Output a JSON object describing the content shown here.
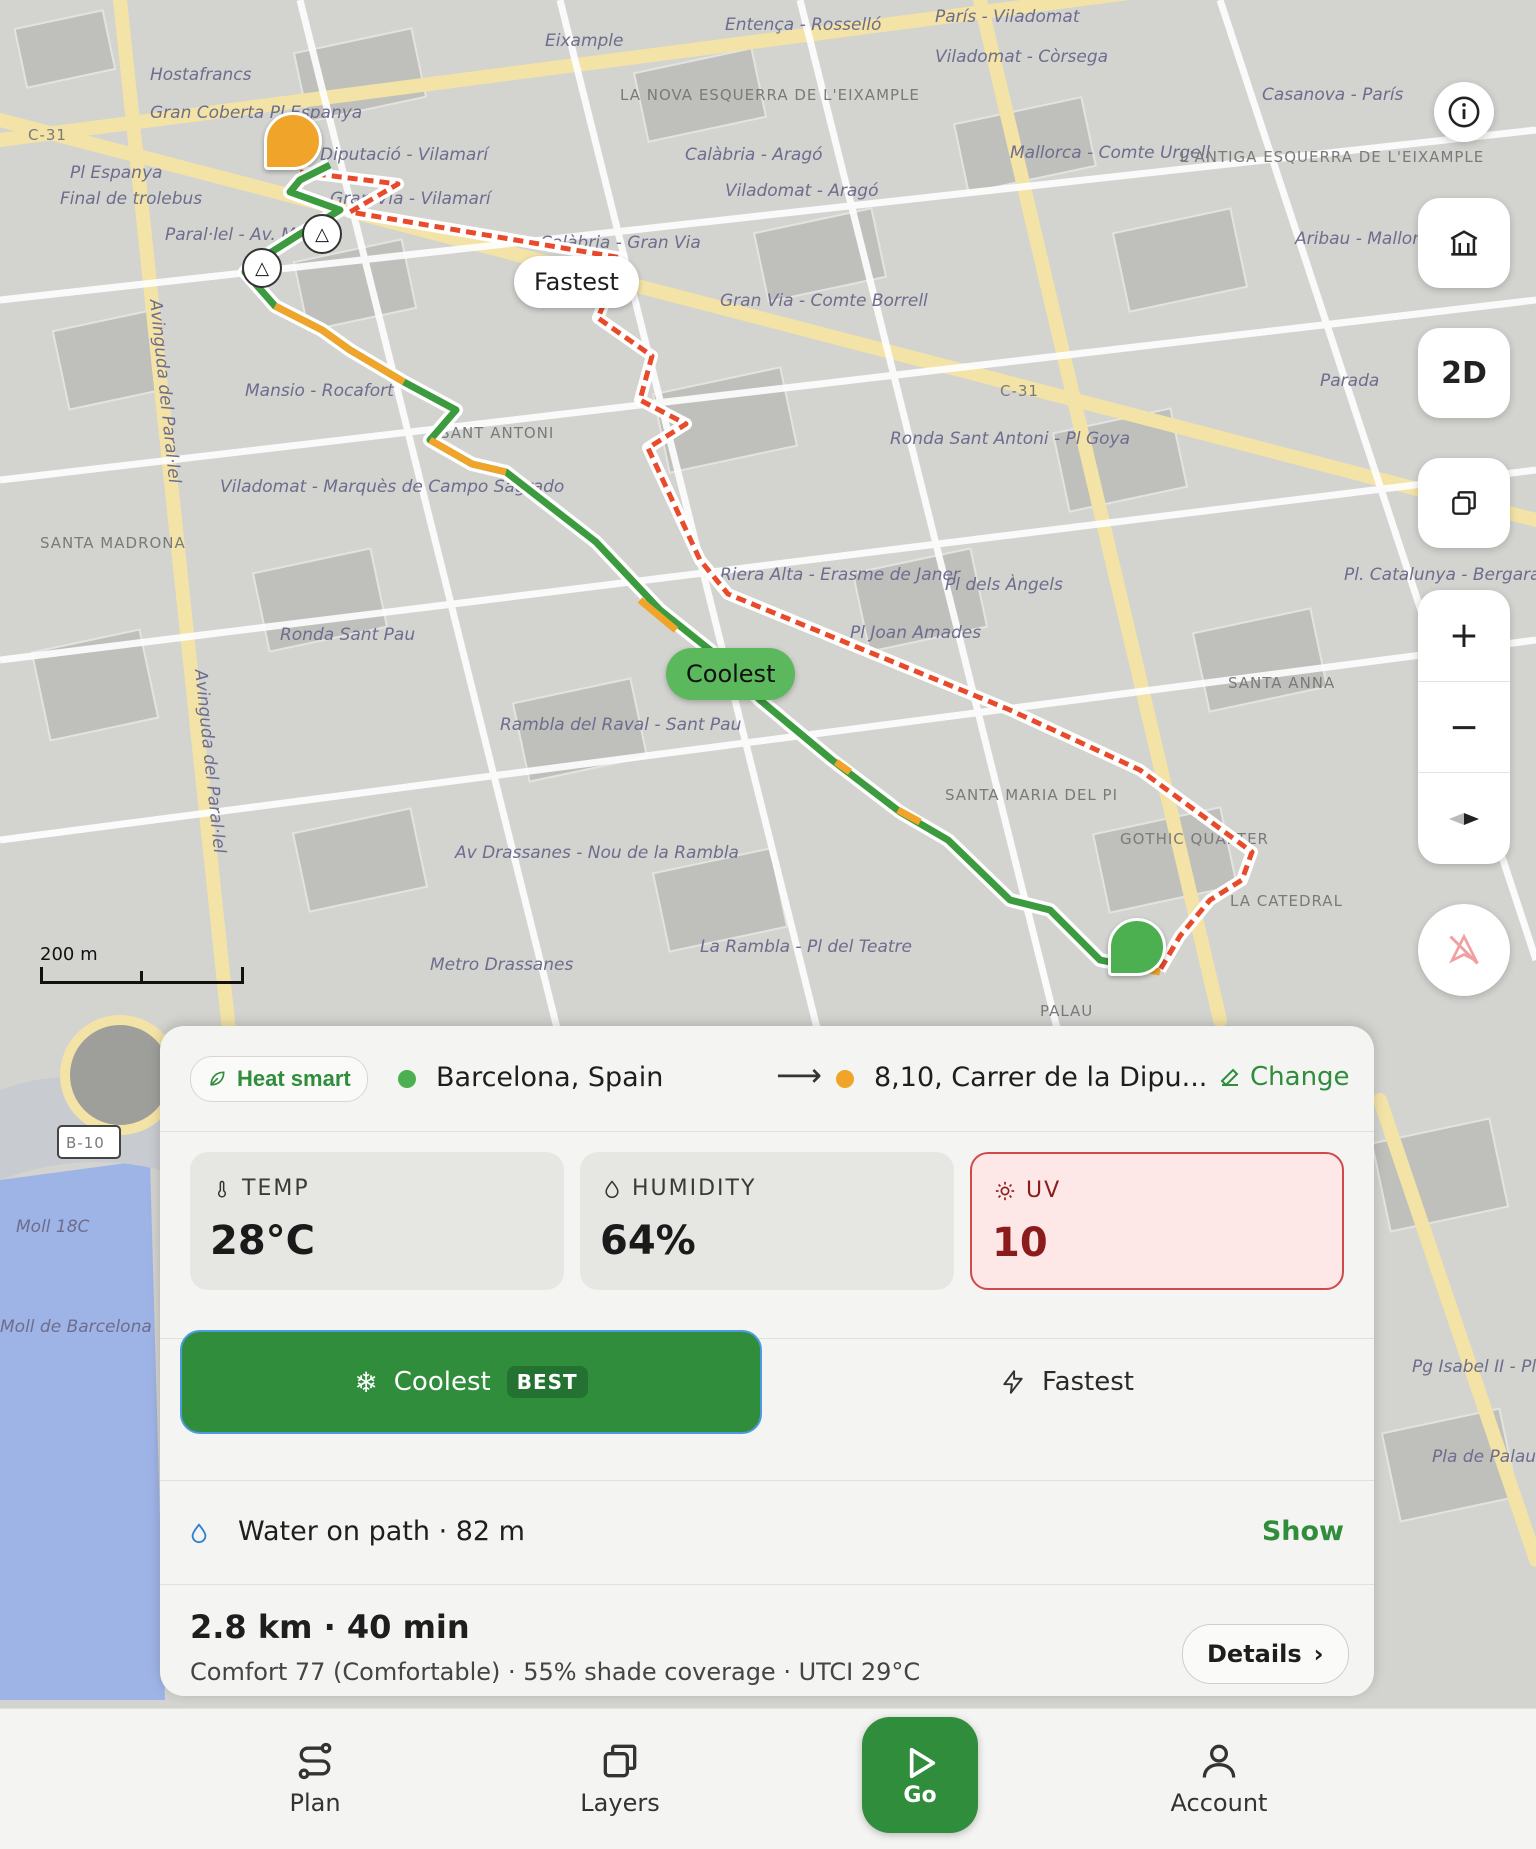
{
  "map": {
    "labels": {
      "hostafrancs": "Hostafrancs",
      "placa_espanya": "Pl Espanya",
      "espanya_stop": "Gran Coberta Pl Espanya",
      "final_trolebus": "Final de trolebus",
      "parallel": "Paral·lel - Av. Mistral",
      "diputacio": "Diputació - Vilamarí",
      "gran_via_vilamari": "Gran Via - Vilamarí",
      "entenca": "Entença - Rosselló",
      "paris": "París - Viladomat",
      "eixample": "Eixample",
      "nova_esquerra": "LA NOVA ESQUERRA DE L'EIXAMPLE",
      "calabria_arago": "Calàbria - Aragó",
      "viladomat_arago": "Viladomat - Aragó",
      "viladomat_corsega": "Viladomat - Còrsega",
      "casanova": "Casanova - París",
      "mallorca": "Mallorca - Comte Urgell",
      "antiga": "L'ANTIGA ESQUERRA DE L'EIXAMPLE",
      "aribau": "Aribau - Mallorca",
      "calabria_granvia": "Calàbria - Gran Via",
      "granvia_borrell": "Gran Via - Comte Borrell",
      "c31": "C-31",
      "c31b": "C-31",
      "ronda_antoni": "Ronda Sant Antoni - Pl Goya",
      "parada": "Parada",
      "mansio": "Mansio - Rocafort",
      "viladomat_marques": "Viladomat - Marquès de Campo Sagrado",
      "santa_madrona": "SANTA MADRONA",
      "sant_antoni": "SANT ANTONI",
      "ronda_pau": "Ronda Sant Pau",
      "riera_alta": "Riera Alta - Erasme de Janer",
      "angels": "Pl dels Àngels",
      "amades": "Pl Joan Amades",
      "pl_catalunya": "Pl. Catalunya - Bergara",
      "santa_anna": "SANTA ANNA",
      "rambla_raval": "Rambla del Raval - Sant Pau",
      "drassanes": "Av Drassanes - Nou de la Rambla",
      "metro_drassanes": "Metro Drassanes",
      "la_rambla": "La Rambla - Pl del Teatre",
      "gothic": "GOTHIC QUARTER",
      "catedral": "LA CATEDRAL",
      "santa_maria": "SANTA MARIA DEL PI",
      "palau": "PALAU",
      "parallel_av": "Avinguda del Paral·lel",
      "parallel_av2": "Avinguda del Paral·lel",
      "moll": "Moll 18C",
      "moll_barcelona": "Moll de Barcelona",
      "b10": "B-10",
      "pg_isabel": "Pg Isabel II - Pla de Palau",
      "pla_palau": "Pla de Palau - Pl Pau Vila"
    },
    "route_labels": {
      "fastest": "Fastest",
      "coolest": "Coolest"
    },
    "scale_label": "200 m",
    "colors": {
      "coolest_route": "#3c9a3f",
      "fastest_route": "#e84a2c",
      "warm_segment": "#f0a52a",
      "start_pin": "#f0a52a",
      "end_pin": "#4caf50"
    }
  },
  "controls": {
    "info_icon": "info-icon",
    "buildings_icon": "building-icon",
    "view_mode": "2D",
    "layers_icon": "layers-icon",
    "zoom_in": "+",
    "zoom_out": "−",
    "compass_icon": "compass-icon",
    "locate_icon": "location-off-icon"
  },
  "panel": {
    "mode_chip": "Heat smart",
    "origin": "Barcelona, Spain",
    "destination": "8,10, Carrer de la Dipu...",
    "change_label": "Change",
    "stats": [
      {
        "label": "TEMP",
        "value": "28°C",
        "icon": "thermometer-icon"
      },
      {
        "label": "HUMIDITY",
        "value": "64%",
        "icon": "droplet-icon"
      },
      {
        "label": "UV",
        "value": "10",
        "icon": "sun-icon",
        "alert": true
      }
    ],
    "options": {
      "coolest_label": "Coolest",
      "coolest_badge": "BEST",
      "fastest_label": "Fastest"
    },
    "water": {
      "text": "Water on path · 82 m",
      "action": "Show"
    },
    "summary": {
      "headline": "2.8 km · 40 min",
      "detail": "Comfort 77 (Comfortable) · 55% shade coverage · UTCI 29°C",
      "details_button": "Details"
    }
  },
  "nav": {
    "plan": "Plan",
    "layers": "Layers",
    "go": "Go",
    "account": "Account"
  }
}
